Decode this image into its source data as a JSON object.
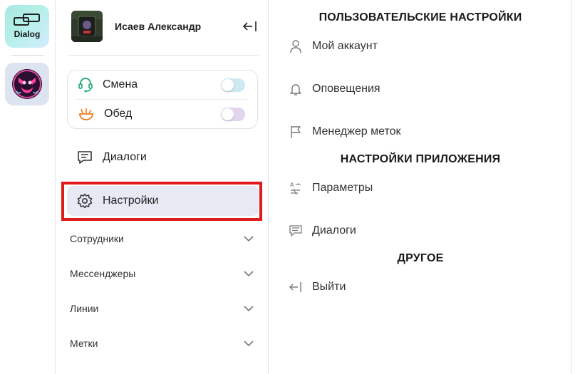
{
  "rail": {
    "apps": [
      {
        "label": "Dialog",
        "icon": "dialog-app-icon"
      },
      {
        "label": "",
        "icon": "avatar-app-icon"
      }
    ]
  },
  "profile": {
    "name": "Исаев Александр",
    "collapse_icon": "collapse-left-icon"
  },
  "status": {
    "items": [
      {
        "label": "Смена",
        "icon": "headset-icon",
        "checked": false,
        "color": "#1aa96b"
      },
      {
        "label": "Обед",
        "icon": "food-bowl-icon",
        "checked": false,
        "color": "#f07a1a"
      }
    ]
  },
  "nav": {
    "items": [
      {
        "label": "Диалоги",
        "icon": "chat-icon"
      },
      {
        "label": "Настройки",
        "icon": "gear-icon",
        "active": true
      }
    ]
  },
  "sections": [
    {
      "label": "Сотрудники"
    },
    {
      "label": "Мессенджеры"
    },
    {
      "label": "Линии"
    },
    {
      "label": "Метки"
    }
  ],
  "settings": {
    "user_heading": "ПОЛЬЗОВАТЕЛЬСКИЕ НАСТРОЙКИ",
    "app_heading": "НАСТРОЙКИ ПРИЛОЖЕНИЯ",
    "other_heading": "ДРУГОЕ",
    "items": [
      {
        "label": "Мой аккаунт",
        "icon": "user-icon"
      },
      {
        "label": "Оповещения",
        "icon": "bell-icon"
      },
      {
        "label": "Менеджер меток",
        "icon": "flag-icon"
      },
      {
        "label": "Параметры",
        "icon": "translate-icon"
      },
      {
        "label": "Диалоги",
        "icon": "message-icon"
      },
      {
        "label": "Выйти",
        "icon": "logout-icon"
      }
    ]
  },
  "colors": {
    "accent_highlight": "#e01b1b",
    "active_bg": "#e7eaf3"
  }
}
